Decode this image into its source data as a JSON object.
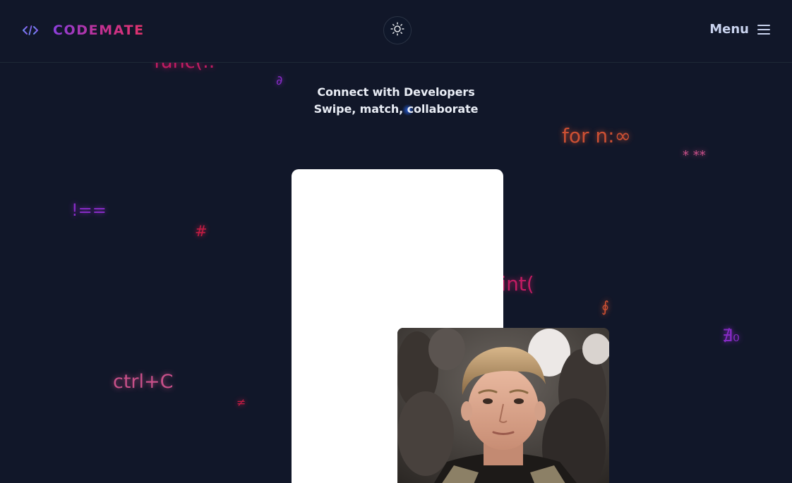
{
  "header": {
    "brand": "CODEMATE",
    "logo_icon": "code-icon",
    "theme_icon": "sun-icon",
    "menu_label": "Menu",
    "menu_icon": "hamburger-icon"
  },
  "tagline": {
    "line1": "Connect with Developers",
    "line2": "Swipe, match, collaborate"
  },
  "floating_symbols": {
    "func": "func(..",
    "tiny_a": "∂",
    "for_loop": "for n:∞",
    "stars": "* **",
    "not_equal": "!==",
    "hash": "#",
    "print": "print(",
    "tiny_b": "∮",
    "tiny_c": "∄₀",
    "ctrl_c": "ctrl+C",
    "tiny_d": "≠"
  },
  "profile_card": {
    "photo_alt": "developer-profile-photo"
  },
  "colors": {
    "background": "#111729",
    "accent_purple": "#8b3fdc",
    "accent_pink": "#e0336a",
    "card": "#ffffff"
  }
}
